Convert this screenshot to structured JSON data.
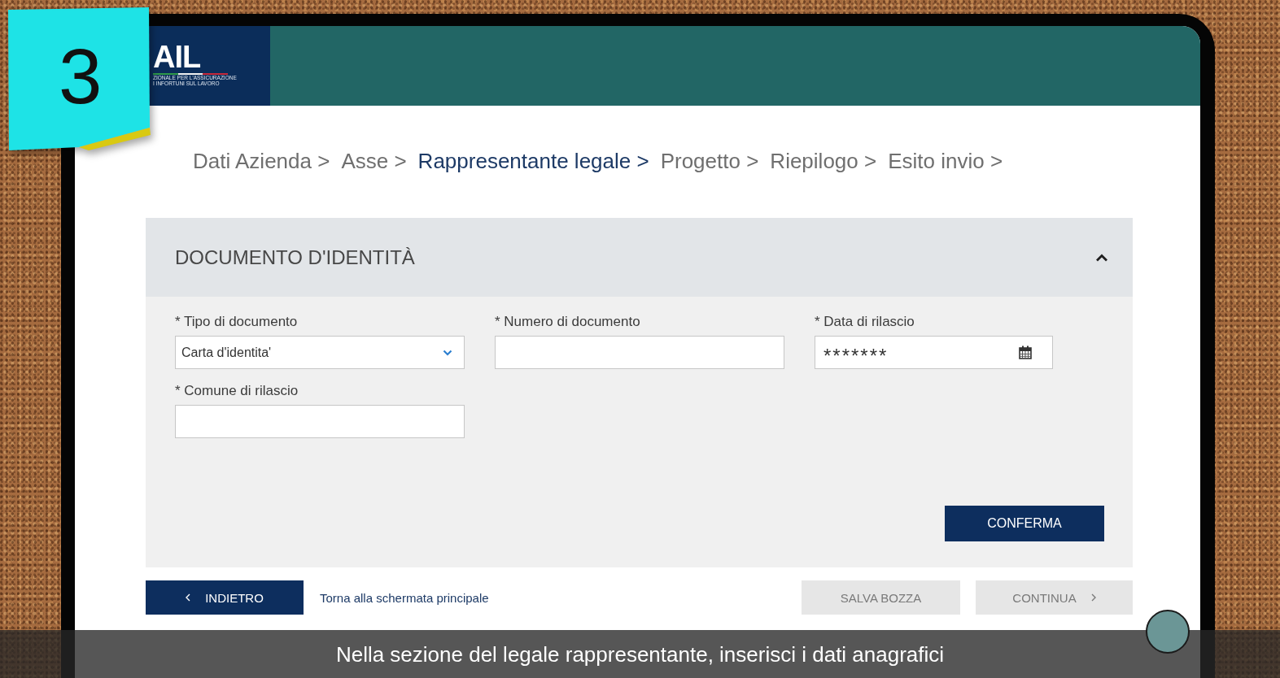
{
  "sticky_note": {
    "number": "3"
  },
  "header": {
    "logo": {
      "text": "AIL",
      "subtitle_lines": [
        "ZIONALE PER L'ASSICURAZIONE",
        "I INFORTUNI SUL LAVORO"
      ]
    }
  },
  "breadcrumb": [
    {
      "label": "Dati Azienda >",
      "current": false
    },
    {
      "label": "Asse >",
      "current": false
    },
    {
      "label": "Rappresentante legale >",
      "current": true
    },
    {
      "label": "Progetto >",
      "current": false
    },
    {
      "label": "Riepilogo >",
      "current": false
    },
    {
      "label": "Esito invio >",
      "current": false
    }
  ],
  "panel": {
    "title": "DOCUMENTO D'IDENTITÀ",
    "expanded": true,
    "fields": [
      {
        "kind": "select",
        "label": "* Tipo di documento",
        "value": "Carta d'identita'"
      },
      {
        "kind": "text",
        "label": "* Numero di documento"
      },
      {
        "kind": "date",
        "label": "* Data di rilascio",
        "value": "*******"
      },
      {
        "kind": "text",
        "label": "* Comune di rilascio"
      }
    ],
    "confirm_button": "CONFERMA"
  },
  "footer": {
    "back_button": "INDIETRO",
    "home_link": "Torna alla schermata principale",
    "save_button": "SALVA BOZZA",
    "continue_button": "CONTINUA"
  },
  "caption": "Nella sezione del legale rappresentante, inserisci i dati anagrafici"
}
